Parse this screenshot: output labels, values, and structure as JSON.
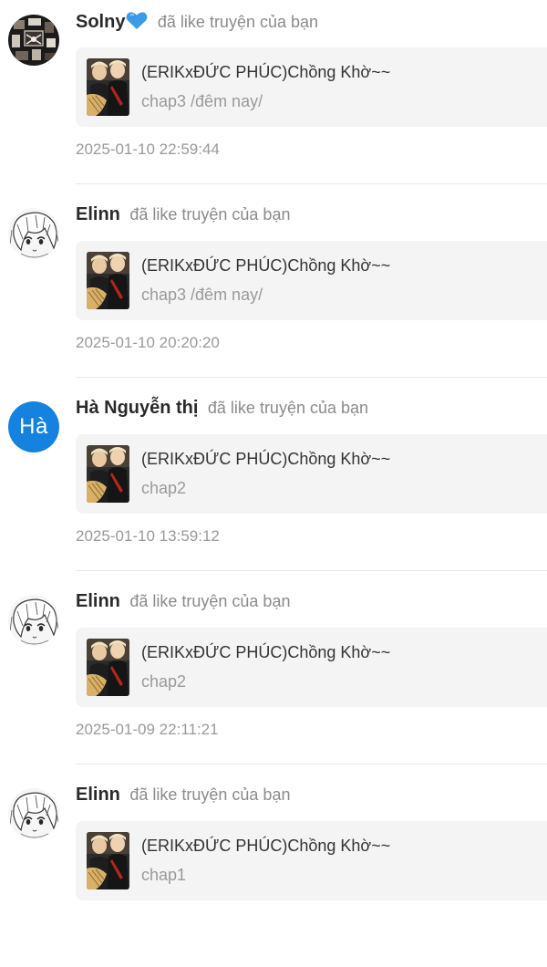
{
  "colors": {
    "background": "#ffffff",
    "card_background": "#f4f4f5",
    "muted_text": "#9a9a9a",
    "avatar_letter_bg": "#1682e0"
  },
  "notifications": [
    {
      "user": "Solny",
      "avatar": "pattern-avatar",
      "badge_icon": "blue-heart-icon",
      "action": "đã like truyện của bạn",
      "story_title": "(ERIKxĐỨC PHÚC)Chồng Khờ~~",
      "chapter": "chap3 /đêm nay/",
      "timestamp": "2025-01-10 22:59:44"
    },
    {
      "user": "Elinn",
      "avatar": "anime-sketch-avatar",
      "action": "đã like truyện của bạn",
      "story_title": "(ERIKxĐỨC PHÚC)Chồng Khờ~~",
      "chapter": "chap3 /đêm nay/",
      "timestamp": "2025-01-10 20:20:20"
    },
    {
      "user": "Hà Nguyễn thị",
      "avatar_text": "Hà",
      "action": "đã like truyện của bạn",
      "story_title": "(ERIKxĐỨC PHÚC)Chồng Khờ~~",
      "chapter": "chap2",
      "timestamp": "2025-01-10 13:59:12"
    },
    {
      "user": "Elinn",
      "avatar": "anime-sketch-avatar",
      "action": "đã like truyện của bạn",
      "story_title": "(ERIKxĐỨC PHÚC)Chồng Khờ~~",
      "chapter": "chap2",
      "timestamp": "2025-01-09 22:11:21"
    },
    {
      "user": "Elinn",
      "avatar": "anime-sketch-avatar",
      "action": "đã like truyện của bạn",
      "story_title": "(ERIKxĐỨC PHÚC)Chồng Khờ~~",
      "chapter": "chap1",
      "timestamp": ""
    }
  ]
}
